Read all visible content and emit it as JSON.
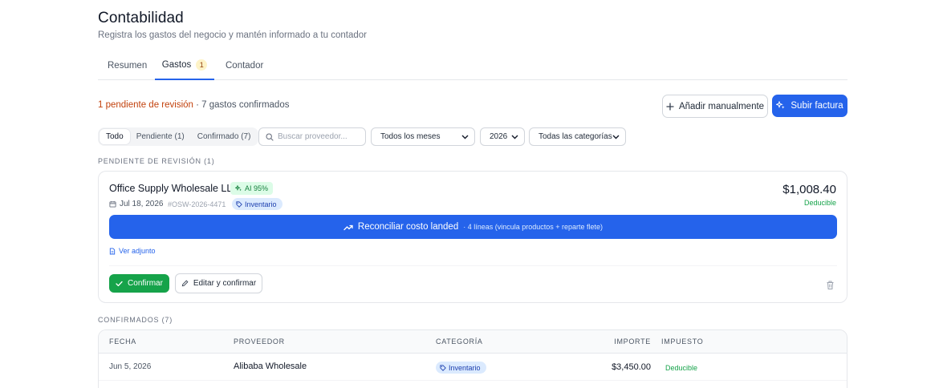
{
  "header": {
    "title": "Contabilidad",
    "subtitle": "Registra los gastos del negocio y mantén informado a tu contador"
  },
  "tabs": [
    {
      "label": "Resumen",
      "active": false
    },
    {
      "label": "Gastos",
      "active": true,
      "badge": "1"
    },
    {
      "label": "Contador",
      "active": false
    }
  ],
  "summary": {
    "pending": "1 pendiente de revisión",
    "separator": " · ",
    "confirmed": "7 gastos confirmados"
  },
  "actions": {
    "add_manual": "Añadir manualmente",
    "upload_invoice": "Subir factura"
  },
  "filters": {
    "segments": [
      {
        "label": "Todo",
        "active": true
      },
      {
        "label": "Pendiente (1)",
        "active": false
      },
      {
        "label": "Confirmado (7)",
        "active": false
      }
    ],
    "search_placeholder": "Buscar proveedor...",
    "month": "Todos los meses",
    "year": "2026",
    "category": "Todas las categorías"
  },
  "pending_section": {
    "label": "PENDIENTE DE REVISIÓN (1)",
    "card": {
      "vendor": "Office Supply Wholesale LLC",
      "ai_badge": "AI 95%",
      "date": "Jul 18, 2026",
      "reference": "#OSW-2026-4471",
      "category": "Inventario",
      "amount": "$1,008.40",
      "tax_status": "Deducible",
      "reconcile_label": "Reconciliar costo landed",
      "reconcile_detail": "· 4 líneas (vincula productos + reparte flete)",
      "attachment": "Ver adjunto",
      "confirm": "Confirmar",
      "edit_confirm": "Editar y confirmar"
    }
  },
  "confirmed_section": {
    "label": "CONFIRMADOS (7)",
    "columns": [
      "FECHA",
      "PROVEEDOR",
      "CATEGORÍA",
      "IMPORTE",
      "IMPUESTO"
    ],
    "rows": [
      {
        "date": "Jun 5, 2026",
        "vendor": "Alibaba Wholesale",
        "category": "Inventario",
        "amount": "$3,450.00",
        "tax": "Deducible"
      }
    ]
  },
  "colors": {
    "primary": "#2563eb",
    "success": "#16a34a",
    "warning": "#c2410c"
  }
}
